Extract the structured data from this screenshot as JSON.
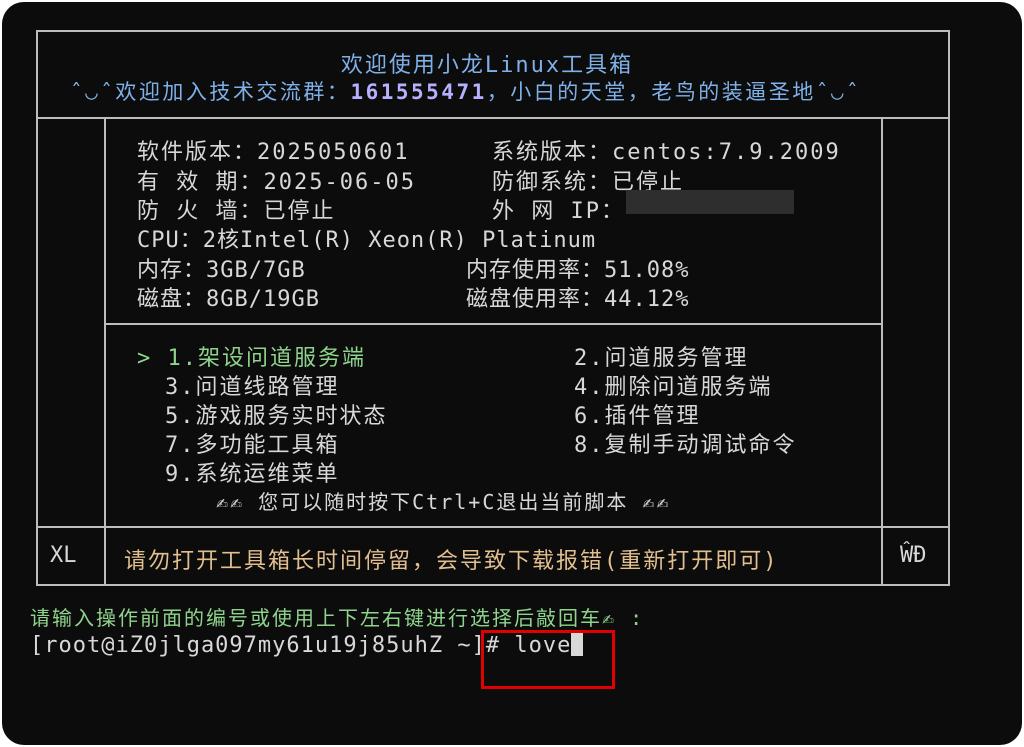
{
  "header": {
    "title": "欢迎使用小龙Linux工具箱",
    "welcome_prefix": "ˆ◡ˆ欢迎加入技术交流群：",
    "group_number": "161555471",
    "welcome_suffix": "，小白的天堂，老鸟的装逼圣地ˆ◡ˆ"
  },
  "info": {
    "software_version_label": "软件版本：",
    "software_version": "2025050601",
    "system_version_label": "系统版本：",
    "system_version": "centos:7.9.2009",
    "validity_label": "有 效 期：",
    "validity": "2025-06-05",
    "defense_label": "防御系统：",
    "defense": "已停止",
    "firewall_label": "防 火 墙：",
    "firewall": "已停止",
    "public_ip_label": "外 网 IP：",
    "cpu_label": "CPU：",
    "cpu": "2核Intel(R) Xeon(R) Platinum",
    "memory_label": "内存：",
    "memory": "3GB/7GB",
    "memory_usage_label": "内存使用率：",
    "memory_usage": "51.08%",
    "disk_label": "磁盘：",
    "disk": "8GB/19GB",
    "disk_usage_label": "磁盘使用率：",
    "disk_usage": "44.12%"
  },
  "menu": {
    "selector": ">",
    "items": [
      "1.架设问道服务端",
      "2.问道服务管理",
      "3.问道线路管理",
      "4.删除问道服务端",
      "5.游戏服务实时状态",
      "6.插件管理",
      "7.多功能工具箱",
      "8.复制手动调试命令",
      "9.系统运维菜单"
    ],
    "hint": "✍✍ 您可以随时按下Ctrl+C退出当前脚本 ✍✍"
  },
  "footer": {
    "left_tag": "XL",
    "warning": "请勿打开工具箱长时间停留，会导致下载报错(重新打开即可)",
    "right_tag": "ŴĐ"
  },
  "prompt": {
    "instruction": "请输入操作前面的编号或使用上下左右键进行选择后敲回车✍ :",
    "shell_prompt": "[root@iZ0jlga097my61u19j85uhZ ~]#",
    "input": "love"
  },
  "colors": {
    "background": "#0c0c0c",
    "border": "#bdbdbd",
    "header_text": "#7fb0e8",
    "group_number": "#b6b1ff",
    "selected_menu": "#8fd48c",
    "warning_text": "#e2bf8e",
    "highlight_box": "#e20000"
  }
}
